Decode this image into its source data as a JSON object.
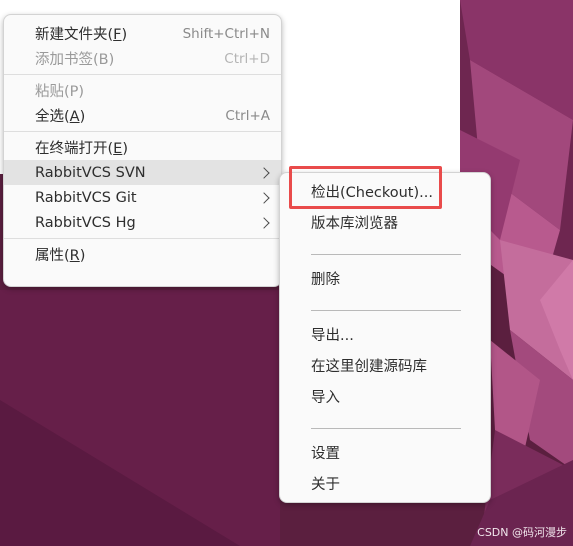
{
  "main_menu": {
    "items": [
      {
        "label": "新建文件夹(",
        "mnemonic": "F",
        "suffix": ")",
        "accel": "Shift+Ctrl+N",
        "disabled": false
      },
      {
        "label": "添加书签(B)",
        "accel": "Ctrl+D",
        "disabled": true
      },
      {
        "label": "粘贴(P)",
        "accel": "",
        "disabled": true
      },
      {
        "label": "全选(",
        "mnemonic": "A",
        "suffix": ")",
        "accel": "Ctrl+A",
        "disabled": false
      },
      {
        "label": "在终端打开(",
        "mnemonic": "E",
        "suffix": ")",
        "accel": "",
        "disabled": false
      },
      {
        "label": "RabbitVCS SVN",
        "submenu": true,
        "highlighted": true
      },
      {
        "label": "RabbitVCS Git",
        "submenu": true
      },
      {
        "label": "RabbitVCS Hg",
        "submenu": true
      },
      {
        "label": "属性(",
        "mnemonic": "R",
        "suffix": ")",
        "accel": "",
        "disabled": false
      }
    ]
  },
  "svn_submenu": {
    "items": [
      {
        "label": "检出(Checkout)..."
      },
      {
        "label": "版本库浏览器"
      },
      {
        "label": "删除"
      },
      {
        "label": "导出..."
      },
      {
        "label": "在这里创建源码库"
      },
      {
        "label": "导入"
      },
      {
        "label": "设置"
      },
      {
        "label": "关于"
      }
    ]
  },
  "watermark": "CSDN @码河漫步",
  "colors": {
    "highlight_box": "#e94b4b",
    "wallpaper_base": "#5b1f3f",
    "menu_bg": "#fafafa"
  }
}
